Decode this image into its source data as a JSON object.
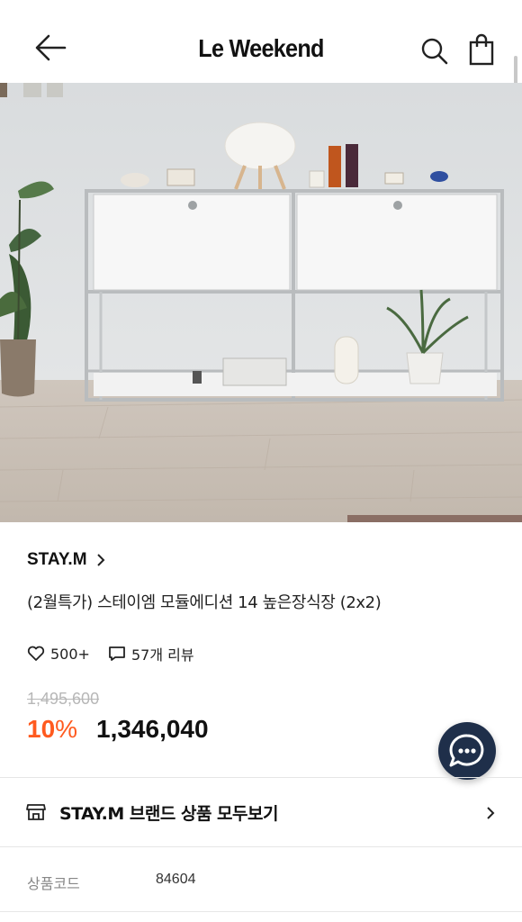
{
  "header": {
    "title": "Le Weekend",
    "back_icon": "arrow-left-icon",
    "search_icon": "search-icon",
    "cart_icon": "shopping-bag-icon"
  },
  "gallery": {
    "image_description": "white modular sideboard with lamp, perfume bottles, cups and plants",
    "progress": 0.25
  },
  "product": {
    "brand": "STAY.M",
    "name": "(2월특가) 스테이엠 모듈에디션 14 높은장식장 (2x2)",
    "likes": "500+",
    "reviews": "57개 리뷰",
    "original_price": "1,495,600",
    "discount": "10",
    "discount_unit": "%",
    "price": "1,346,040"
  },
  "brand_link": {
    "label": "STAY.M 브랜드 상품 모두보기"
  },
  "info": {
    "code_label": "상품코드",
    "code_value": "84604"
  },
  "colors": {
    "discount": "#ff5a1f",
    "chat_button": "#1f2f4a",
    "original_price": "#b7b7b7"
  }
}
